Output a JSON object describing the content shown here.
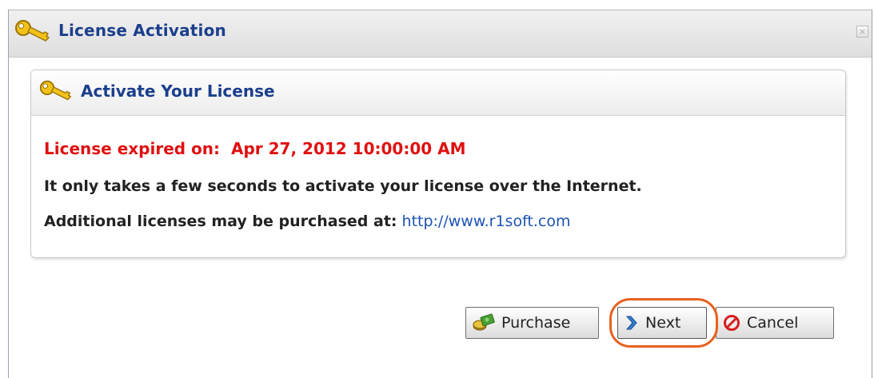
{
  "dialog": {
    "title": "License Activation",
    "close_label": "×"
  },
  "panel": {
    "title": "Activate Your License",
    "expired_label": "License expired on:",
    "expired_date": "Apr 27, 2012 10:00:00 AM",
    "info_text": "It only takes a few seconds to activate your license over the Internet.",
    "purchase_text": "Additional licenses may be purchased at:",
    "purchase_link": "http://www.r1soft.com"
  },
  "buttons": {
    "purchase": "Purchase",
    "next": "Next",
    "cancel": "Cancel"
  },
  "colors": {
    "title": "#1b3f8c",
    "expired": "#e01010",
    "link": "#1d53b5",
    "highlight": "#e8611f"
  },
  "icons": {
    "title": "key-icon",
    "panel": "key-icon",
    "purchase": "coins-icon",
    "next": "chevron-right-icon",
    "cancel": "no-entry-icon"
  }
}
